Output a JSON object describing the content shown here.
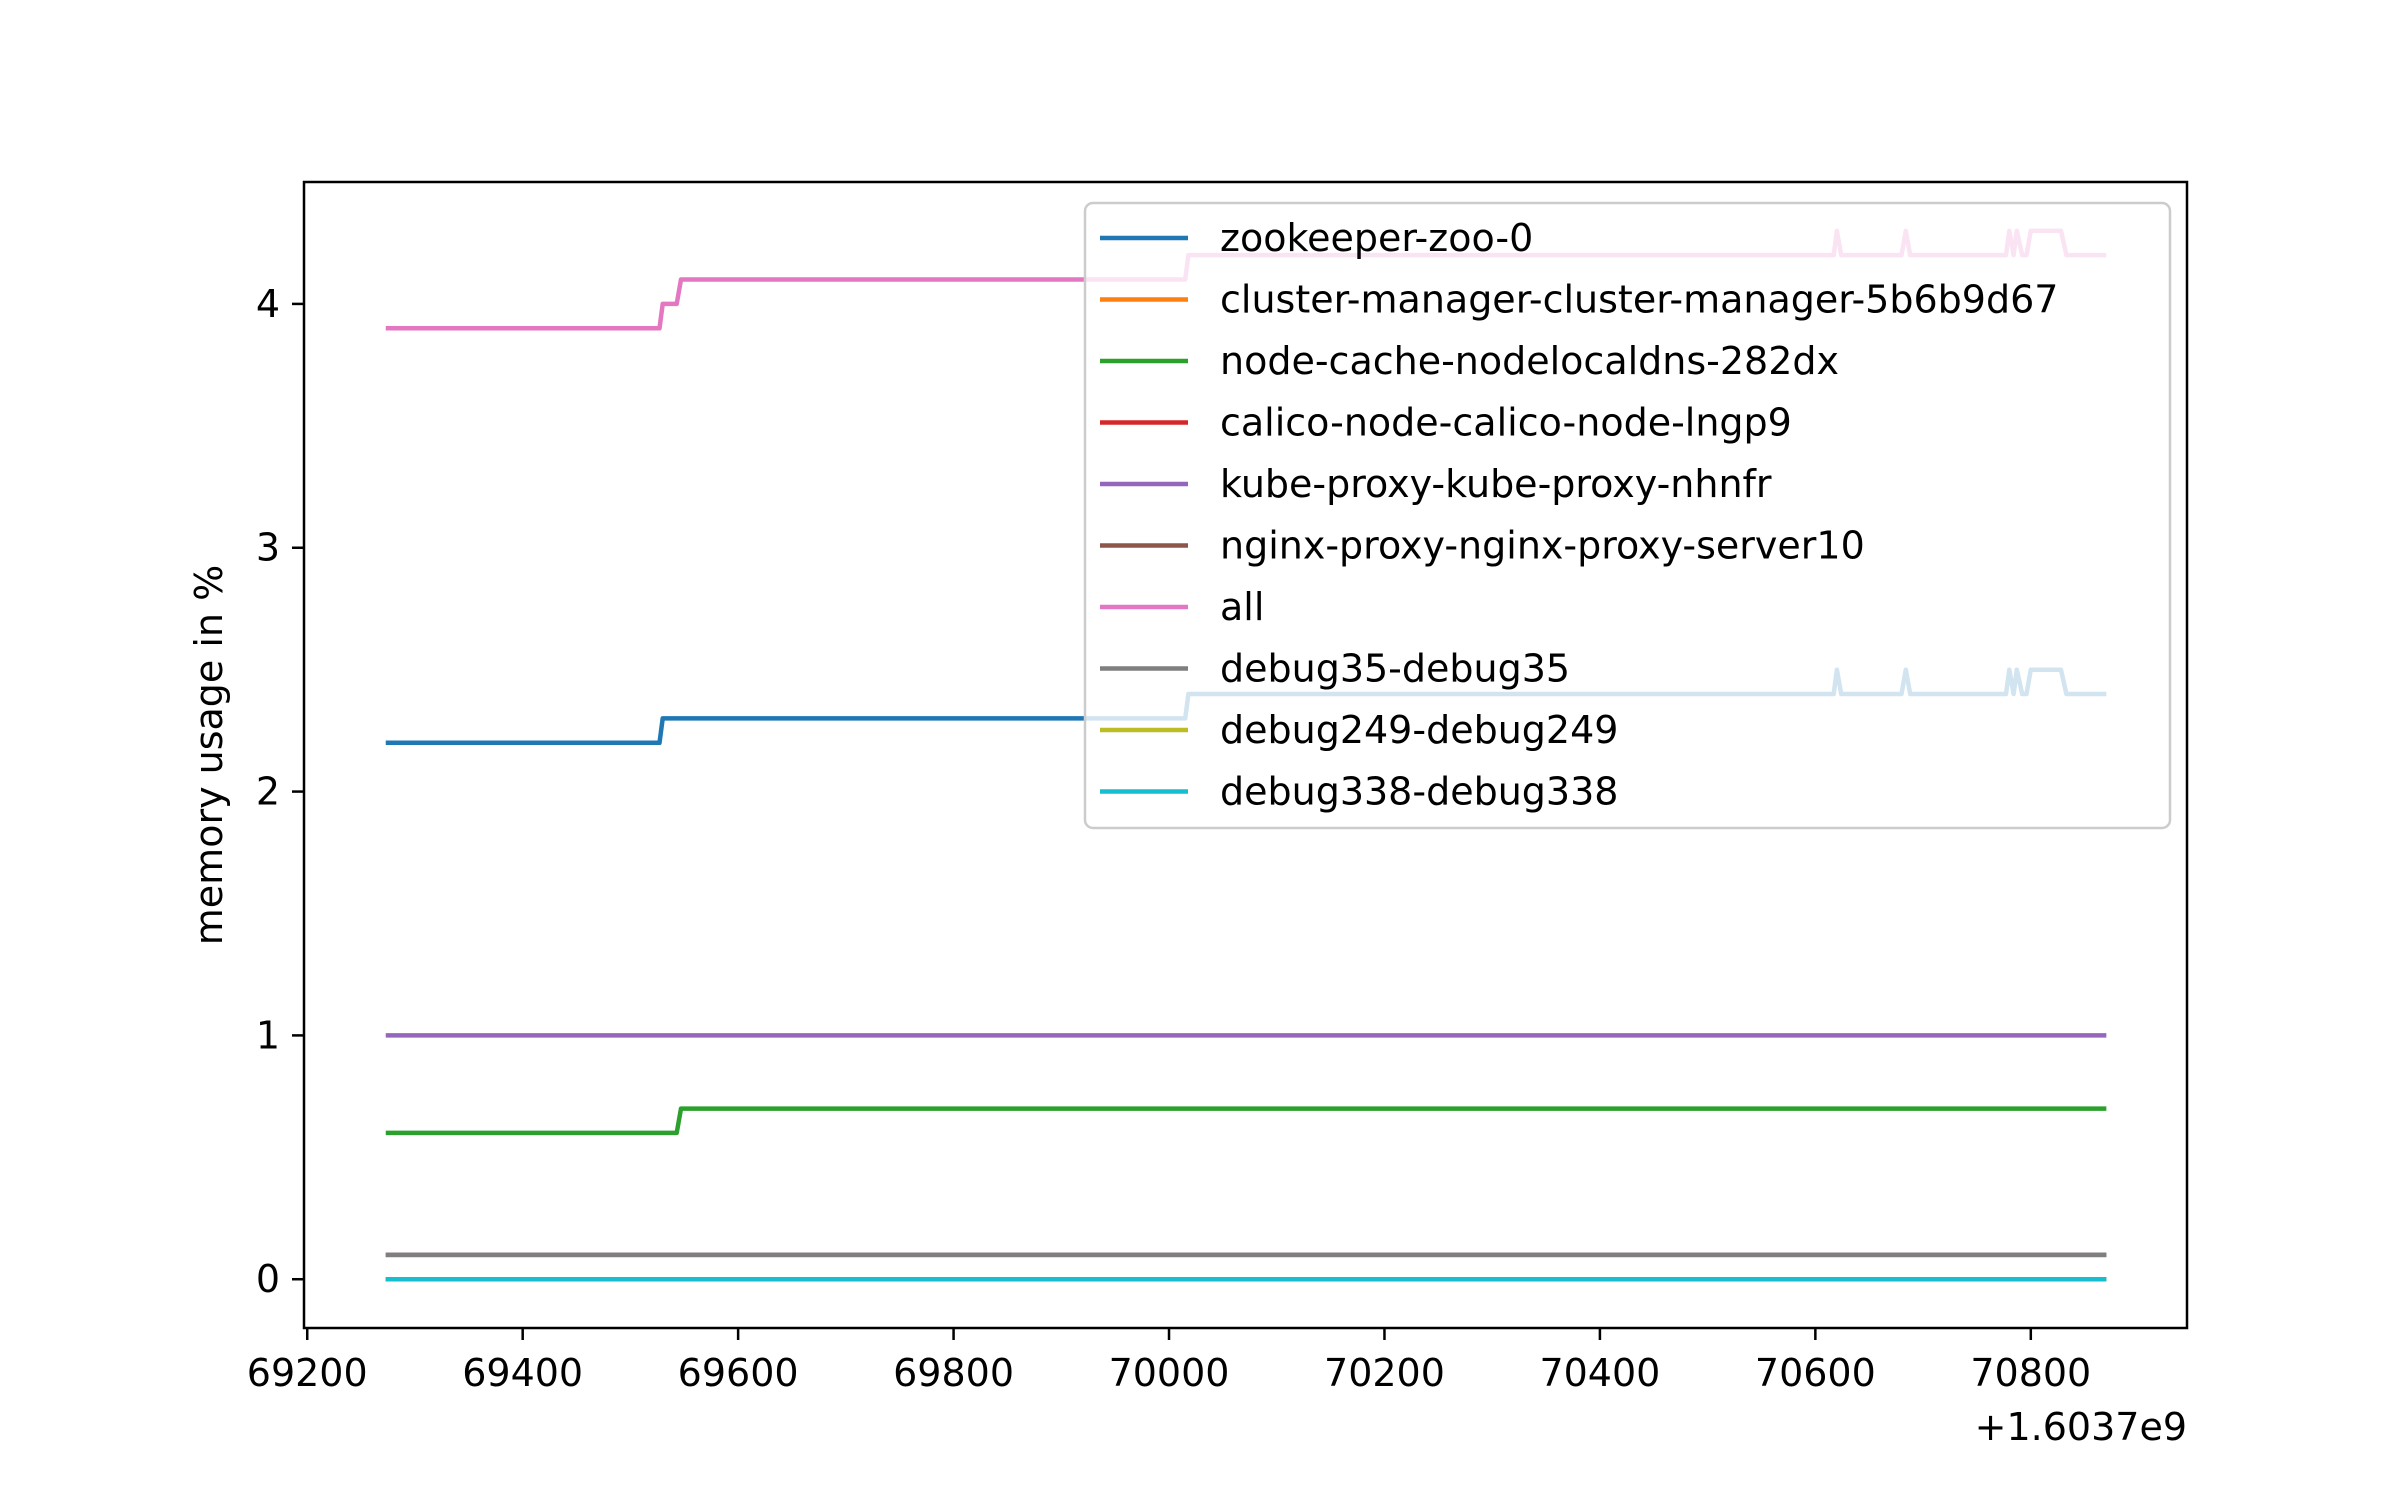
{
  "chart_data": {
    "type": "line",
    "title": "",
    "xlabel": "",
    "ylabel": "memory usage in %",
    "x_offset_label": "+1.6037e9",
    "xlim": [
      69197,
      70945
    ],
    "ylim": [
      -0.2,
      4.5
    ],
    "x_ticks": [
      69200,
      69400,
      69600,
      69800,
      70000,
      70200,
      70400,
      70600,
      70800
    ],
    "y_ticks": [
      0,
      1,
      2,
      3,
      4
    ],
    "grid": false,
    "legend_position": "upper right",
    "series": [
      {
        "name": "zookeeper-zoo-0",
        "color": "#1f77b4",
        "points": [
          [
            69275,
            2.2
          ],
          [
            69527,
            2.2
          ],
          [
            69530,
            2.3
          ],
          [
            70015,
            2.3
          ],
          [
            70018,
            2.4
          ],
          [
            70617,
            2.4
          ],
          [
            70620,
            2.5
          ],
          [
            70624,
            2.4
          ],
          [
            70680,
            2.4
          ],
          [
            70684,
            2.5
          ],
          [
            70688,
            2.4
          ],
          [
            70777,
            2.4
          ],
          [
            70780,
            2.5
          ],
          [
            70784,
            2.4
          ],
          [
            70787,
            2.5
          ],
          [
            70792,
            2.4
          ],
          [
            70796,
            2.4
          ],
          [
            70800,
            2.5
          ],
          [
            70828,
            2.5
          ],
          [
            70833,
            2.4
          ],
          [
            70868,
            2.4
          ]
        ]
      },
      {
        "name": "cluster-manager-cluster-manager-5b6b9d67",
        "color": "#ff7f0e",
        "points": [
          [
            69275,
            0.0
          ],
          [
            70868,
            0.0
          ]
        ]
      },
      {
        "name": "node-cache-nodelocaldns-282dx",
        "color": "#2ca02c",
        "points": [
          [
            69275,
            0.6
          ],
          [
            69543,
            0.6
          ],
          [
            69547,
            0.7
          ],
          [
            70868,
            0.7
          ]
        ]
      },
      {
        "name": "calico-node-calico-node-lngp9",
        "color": "#d62728",
        "points": [
          [
            69275,
            0.0
          ],
          [
            70868,
            0.0
          ]
        ]
      },
      {
        "name": "kube-proxy-kube-proxy-nhnfr",
        "color": "#9467bd",
        "points": [
          [
            69275,
            1.0
          ],
          [
            70868,
            1.0
          ]
        ]
      },
      {
        "name": "nginx-proxy-nginx-proxy-server10",
        "color": "#8c564b",
        "points": [
          [
            69275,
            0.1
          ],
          [
            70868,
            0.1
          ]
        ]
      },
      {
        "name": "all",
        "color": "#e377c2",
        "points": [
          [
            69275,
            3.9
          ],
          [
            69527,
            3.9
          ],
          [
            69530,
            4.0
          ],
          [
            69543,
            4.0
          ],
          [
            69547,
            4.1
          ],
          [
            70015,
            4.1
          ],
          [
            70018,
            4.2
          ],
          [
            70617,
            4.2
          ],
          [
            70620,
            4.3
          ],
          [
            70624,
            4.2
          ],
          [
            70680,
            4.2
          ],
          [
            70684,
            4.3
          ],
          [
            70688,
            4.2
          ],
          [
            70777,
            4.2
          ],
          [
            70780,
            4.3
          ],
          [
            70784,
            4.2
          ],
          [
            70787,
            4.3
          ],
          [
            70792,
            4.2
          ],
          [
            70796,
            4.2
          ],
          [
            70800,
            4.3
          ],
          [
            70828,
            4.3
          ],
          [
            70833,
            4.2
          ],
          [
            70868,
            4.2
          ]
        ]
      },
      {
        "name": "debug35-debug35",
        "color": "#7f7f7f",
        "points": [
          [
            69275,
            0.1
          ],
          [
            70868,
            0.1
          ]
        ]
      },
      {
        "name": "debug249-debug249",
        "color": "#bcbd22",
        "points": [
          [
            69275,
            0.0
          ],
          [
            70868,
            0.0
          ]
        ]
      },
      {
        "name": "debug338-debug338",
        "color": "#17becf",
        "points": [
          [
            69275,
            0.0
          ],
          [
            70868,
            0.0
          ]
        ]
      }
    ]
  }
}
